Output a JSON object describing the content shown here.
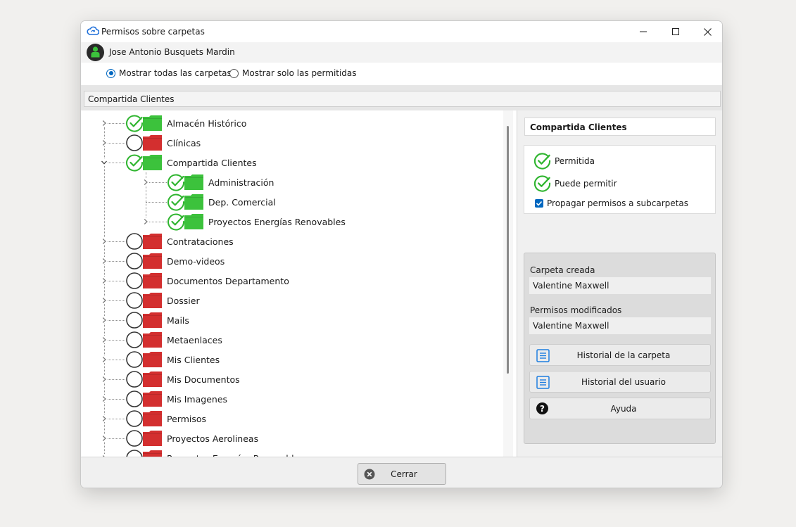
{
  "window": {
    "title": "Permisos sobre carpetas"
  },
  "user": {
    "name": "Jose Antonio Busquets Mardin"
  },
  "view_options": [
    {
      "label": "Mostrar todas las carpetas",
      "selected": true
    },
    {
      "label": "Mostrar solo las permitidas",
      "selected": false
    }
  ],
  "path": "Compartida Clientes",
  "tree": [
    {
      "label": "Almacén Histórico",
      "level": 0,
      "allowed": true,
      "expander": "collapsed"
    },
    {
      "label": "Clínicas",
      "level": 0,
      "allowed": false,
      "expander": "collapsed"
    },
    {
      "label": "Compartida Clientes",
      "level": 0,
      "allowed": true,
      "expander": "expanded"
    },
    {
      "label": "Administración",
      "level": 1,
      "allowed": true,
      "expander": "collapsed"
    },
    {
      "label": "Dep. Comercial",
      "level": 1,
      "allowed": true,
      "expander": "none"
    },
    {
      "label": "Proyectos Energías Renovables",
      "level": 1,
      "allowed": true,
      "expander": "collapsed"
    },
    {
      "label": "Contrataciones",
      "level": 0,
      "allowed": false,
      "expander": "collapsed"
    },
    {
      "label": "Demo-videos",
      "level": 0,
      "allowed": false,
      "expander": "collapsed"
    },
    {
      "label": "Documentos Departamento",
      "level": 0,
      "allowed": false,
      "expander": "collapsed"
    },
    {
      "label": "Dossier",
      "level": 0,
      "allowed": false,
      "expander": "collapsed"
    },
    {
      "label": "Mails",
      "level": 0,
      "allowed": false,
      "expander": "collapsed"
    },
    {
      "label": "Metaenlaces",
      "level": 0,
      "allowed": false,
      "expander": "collapsed"
    },
    {
      "label": "Mis Clientes",
      "level": 0,
      "allowed": false,
      "expander": "collapsed"
    },
    {
      "label": "Mis Documentos",
      "level": 0,
      "allowed": false,
      "expander": "collapsed"
    },
    {
      "label": "Mis Imagenes",
      "level": 0,
      "allowed": false,
      "expander": "collapsed"
    },
    {
      "label": "Permisos",
      "level": 0,
      "allowed": false,
      "expander": "collapsed"
    },
    {
      "label": "Proyectos Aerolineas",
      "level": 0,
      "allowed": false,
      "expander": "collapsed"
    },
    {
      "label": "Proyectos Energías Renovables",
      "level": 0,
      "allowed": false,
      "expander": "collapsed"
    }
  ],
  "details": {
    "folder_name": "Compartida Clientes",
    "status_permitida": "Permitida",
    "status_puede_permitir": "Puede permitir",
    "propagate_label": "Propagar permisos a subcarpetas",
    "propagate_checked": true,
    "created_label": "Carpeta creada",
    "created_value": "Valentine Maxwell",
    "modified_label": "Permisos modificados",
    "modified_value": "Valentine Maxwell",
    "btn_folder_history": "Historial de la carpeta",
    "btn_user_history": "Historial del usuario",
    "btn_help": "Ayuda"
  },
  "footer": {
    "close_label": "Cerrar"
  },
  "colors": {
    "allowed_green": "#3cc23c",
    "denied_red": "#d32f2f",
    "check_green": "#2fb52f",
    "accent_blue": "#0067c0"
  }
}
